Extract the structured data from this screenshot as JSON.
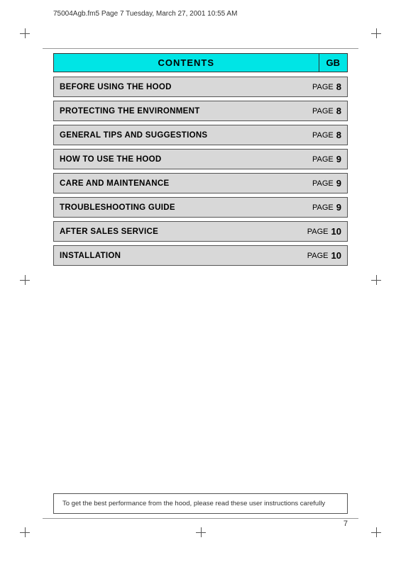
{
  "fileinfo": {
    "text": "75004Agb.fm5  Page 7  Tuesday, March 27, 2001  10:55 AM"
  },
  "header": {
    "title": "CONTENTS",
    "gb_label": "GB"
  },
  "toc": {
    "rows": [
      {
        "label": "BEFORE USING THE HOOD",
        "page_text": "PAGE",
        "page_num": "8"
      },
      {
        "label": "PROTECTING THE ENVIRONMENT",
        "page_text": "PAGE",
        "page_num": "8"
      },
      {
        "label": "GENERAL TIPS AND SUGGESTIONS",
        "page_text": "PAGE",
        "page_num": "8"
      },
      {
        "label": "HOW TO USE THE HOOD",
        "page_text": "PAGE",
        "page_num": "9"
      },
      {
        "label": "CARE AND MAINTENANCE",
        "page_text": "PAGE",
        "page_num": "9"
      },
      {
        "label": "TROUBLESHOOTING GUIDE",
        "page_text": "PAGE",
        "page_num": "9"
      },
      {
        "label": "AFTER SALES SERVICE",
        "page_text": "PAGE",
        "page_num": "10"
      },
      {
        "label": "INSTALLATION",
        "page_text": "PAGE",
        "page_num": "10"
      }
    ]
  },
  "bottom_note": {
    "text": "To get the best performance from the hood, please read these user instructions carefully"
  },
  "page_number": "7"
}
